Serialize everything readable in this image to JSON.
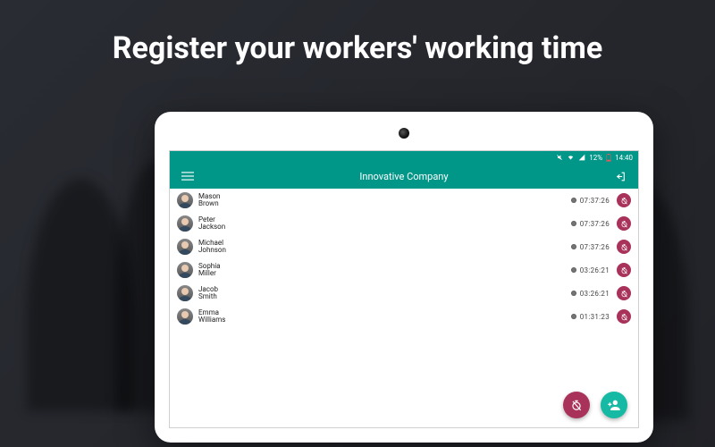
{
  "marketing_headline": "Register your workers' working time",
  "statusbar": {
    "battery_text": "12%",
    "clock": "14:40"
  },
  "appbar": {
    "title": "Innovative Company"
  },
  "workers": [
    {
      "first": "Mason",
      "last": "Brown",
      "time": "07:37:26"
    },
    {
      "first": "Peter",
      "last": "Jackson",
      "time": "07:37:26"
    },
    {
      "first": "Michael",
      "last": "Johnson",
      "time": "07:37:26"
    },
    {
      "first": "Sophia",
      "last": "Miller",
      "time": "03:26:21"
    },
    {
      "first": "Jacob",
      "last": "Smith",
      "time": "03:26:21"
    },
    {
      "first": "Emma",
      "last": "Williams",
      "time": "01:31:23"
    }
  ]
}
